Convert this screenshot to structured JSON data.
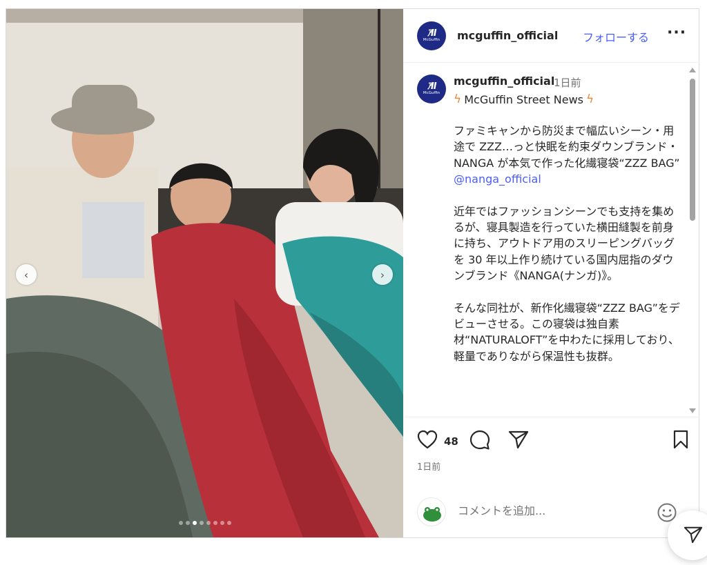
{
  "header": {
    "username": "mcguffin_official",
    "follow_label": "フォローする",
    "more_label": "···"
  },
  "avatar": {
    "mark": "ｱII",
    "word": "McGuffin"
  },
  "caption": {
    "username": "mcguffin_official",
    "time": "1日前",
    "title": "McGuffin Street News",
    "paragraph1": "ファミキャンから防災まで幅広いシーン・用途で ZZZ…っと快眠を約束ダウンブランド・NANGA が本気で作った化繊寝袋“ZZZ BAG”",
    "mention": "@nanga_official",
    "paragraph2": "近年ではファッションシーンでも支持を集めるが、寝具製造を行っていた横田縫製を前身に持ち、アウトドア用のスリーピングバッグを 30 年以上作り続けている国内屈指のダウンブランド《NANGA(ナンガ)》。",
    "paragraph3": "そんな同社が、新作化繊寝袋“ZZZ BAG”をデビューさせる。この寝袋は独自素材“NATURALOFT”を中わたに採用しており、軽量でありながら保温性も抜群。"
  },
  "actions": {
    "like_count": "48",
    "post_time": "1日前"
  },
  "comment": {
    "placeholder": "コメントを追加..."
  },
  "carousel": {
    "dot_count": 8,
    "active_index": 2
  },
  "colors": {
    "link": "#4a5df9",
    "brand": "#1f2a86",
    "muted": "#737373"
  }
}
